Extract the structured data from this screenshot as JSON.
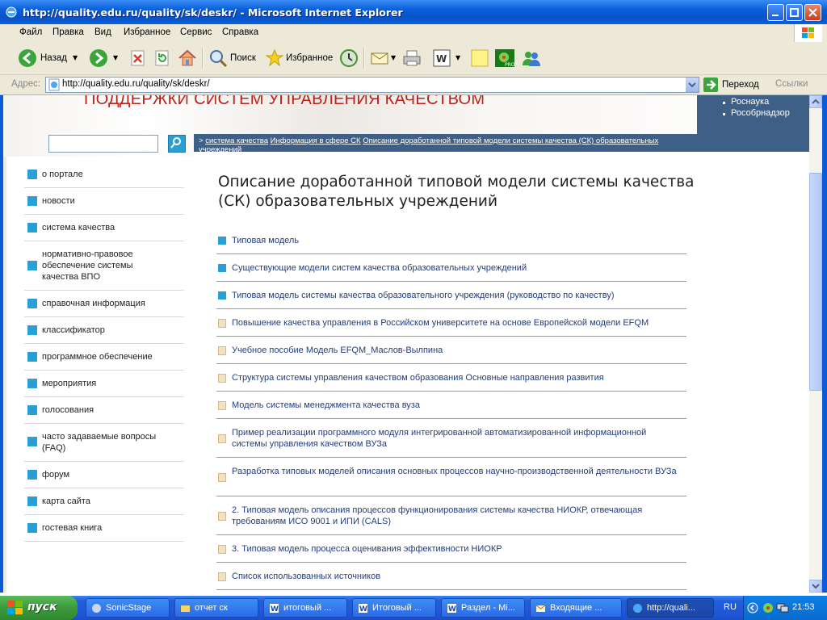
{
  "window": {
    "title": "http://quality.edu.ru/quality/sk/deskr/ - Microsoft Internet Explorer"
  },
  "menu": [
    "Файл",
    "Правка",
    "Вид",
    "Избранное",
    "Сервис",
    "Справка"
  ],
  "toolbar": {
    "back_label": "Назад",
    "search_label": "Поиск",
    "favorites_label": "Избранное"
  },
  "address": {
    "label": "Адрес:",
    "url": "http://quality.edu.ru/quality/sk/deskr/",
    "go_label": "Переход",
    "links_label": "Ссылки"
  },
  "site": {
    "header_title": "ПОДДЕРЖКИ СИСТЕМ УПРАВЛЕНИЯ КАЧЕСТВОМ",
    "header_links": [
      "Роснаука",
      "Рособрнадзор"
    ],
    "breadcrumb": {
      "prefix": ">",
      "items": [
        "система качества",
        "Информация в сфере СК",
        "Описание доработанной типовой модели системы качества (СК) образовательных"
      ],
      "overflow": "учреждений"
    },
    "nav": [
      {
        "label": "о портале"
      },
      {
        "label": "новости"
      },
      {
        "label": "система качества"
      },
      {
        "label": "нормативно-правовое обеспечение системы качества ВПО"
      },
      {
        "label": "справочная информация"
      },
      {
        "label": "классификатор"
      },
      {
        "label": "программное обеспечение"
      },
      {
        "label": "мероприятия"
      },
      {
        "label": "голосования"
      },
      {
        "label": "часто задаваемые вопросы (FAQ)"
      },
      {
        "label": "форум"
      },
      {
        "label": "карта сайта"
      },
      {
        "label": "гостевая книга"
      }
    ],
    "page_title": "Описание доработанной типовой модели системы качества (СК) образовательных учреждений",
    "items": [
      {
        "type": "folder",
        "label": "Типовая модель"
      },
      {
        "type": "folder",
        "label": "Существующие модели систем качества образовательных учреждений"
      },
      {
        "type": "folder",
        "label": "Типовая модель системы качества образовательного учреждения (руководство по качеству)"
      },
      {
        "type": "doc",
        "label": "Повышение качества управления в Российском университете на основе Европейской модели EFQM"
      },
      {
        "type": "doc",
        "label": "Учебное пособие Модель EFQM_Маслов-Вылпина"
      },
      {
        "type": "doc",
        "label": "Структура системы управления качеством образования Основные направления развития"
      },
      {
        "type": "doc",
        "label": "Модель системы менеджмента качества вуза"
      },
      {
        "type": "doc",
        "label": "Пример реализации программного модуля интегрированной автоматизированной информационной системы управления качеством ВУЗа"
      },
      {
        "type": "doc",
        "label": "Разработка типовых моделей описания основных процессов научно-производственной деятельности ВУЗа"
      },
      {
        "type": "doc",
        "label": "2. Типовая модель описания процессов функционирования системы качества НИОКР, отвечающая требованиям ИСО 9001 и ИПИ (CALS)"
      },
      {
        "type": "doc",
        "label": "3. Типовая модель процесса оценивания эффективности НИОКР"
      },
      {
        "type": "doc",
        "label": "Список использованных источников"
      }
    ]
  },
  "taskbar": {
    "start_label": "пуск",
    "tasks": [
      "SonicStage",
      "отчет ск",
      "итоговый ...",
      "Итоговый ...",
      "Раздел - Mi...",
      "Входящие ...",
      "http://quali..."
    ],
    "lang": "RU",
    "clock": "21:53"
  },
  "colors": {
    "title_bar": "#0a5fd8",
    "nav_blue": "#3e5f86",
    "accent": "#2a9fd6",
    "header_red": "#b8231b",
    "link": "#233d7a"
  }
}
